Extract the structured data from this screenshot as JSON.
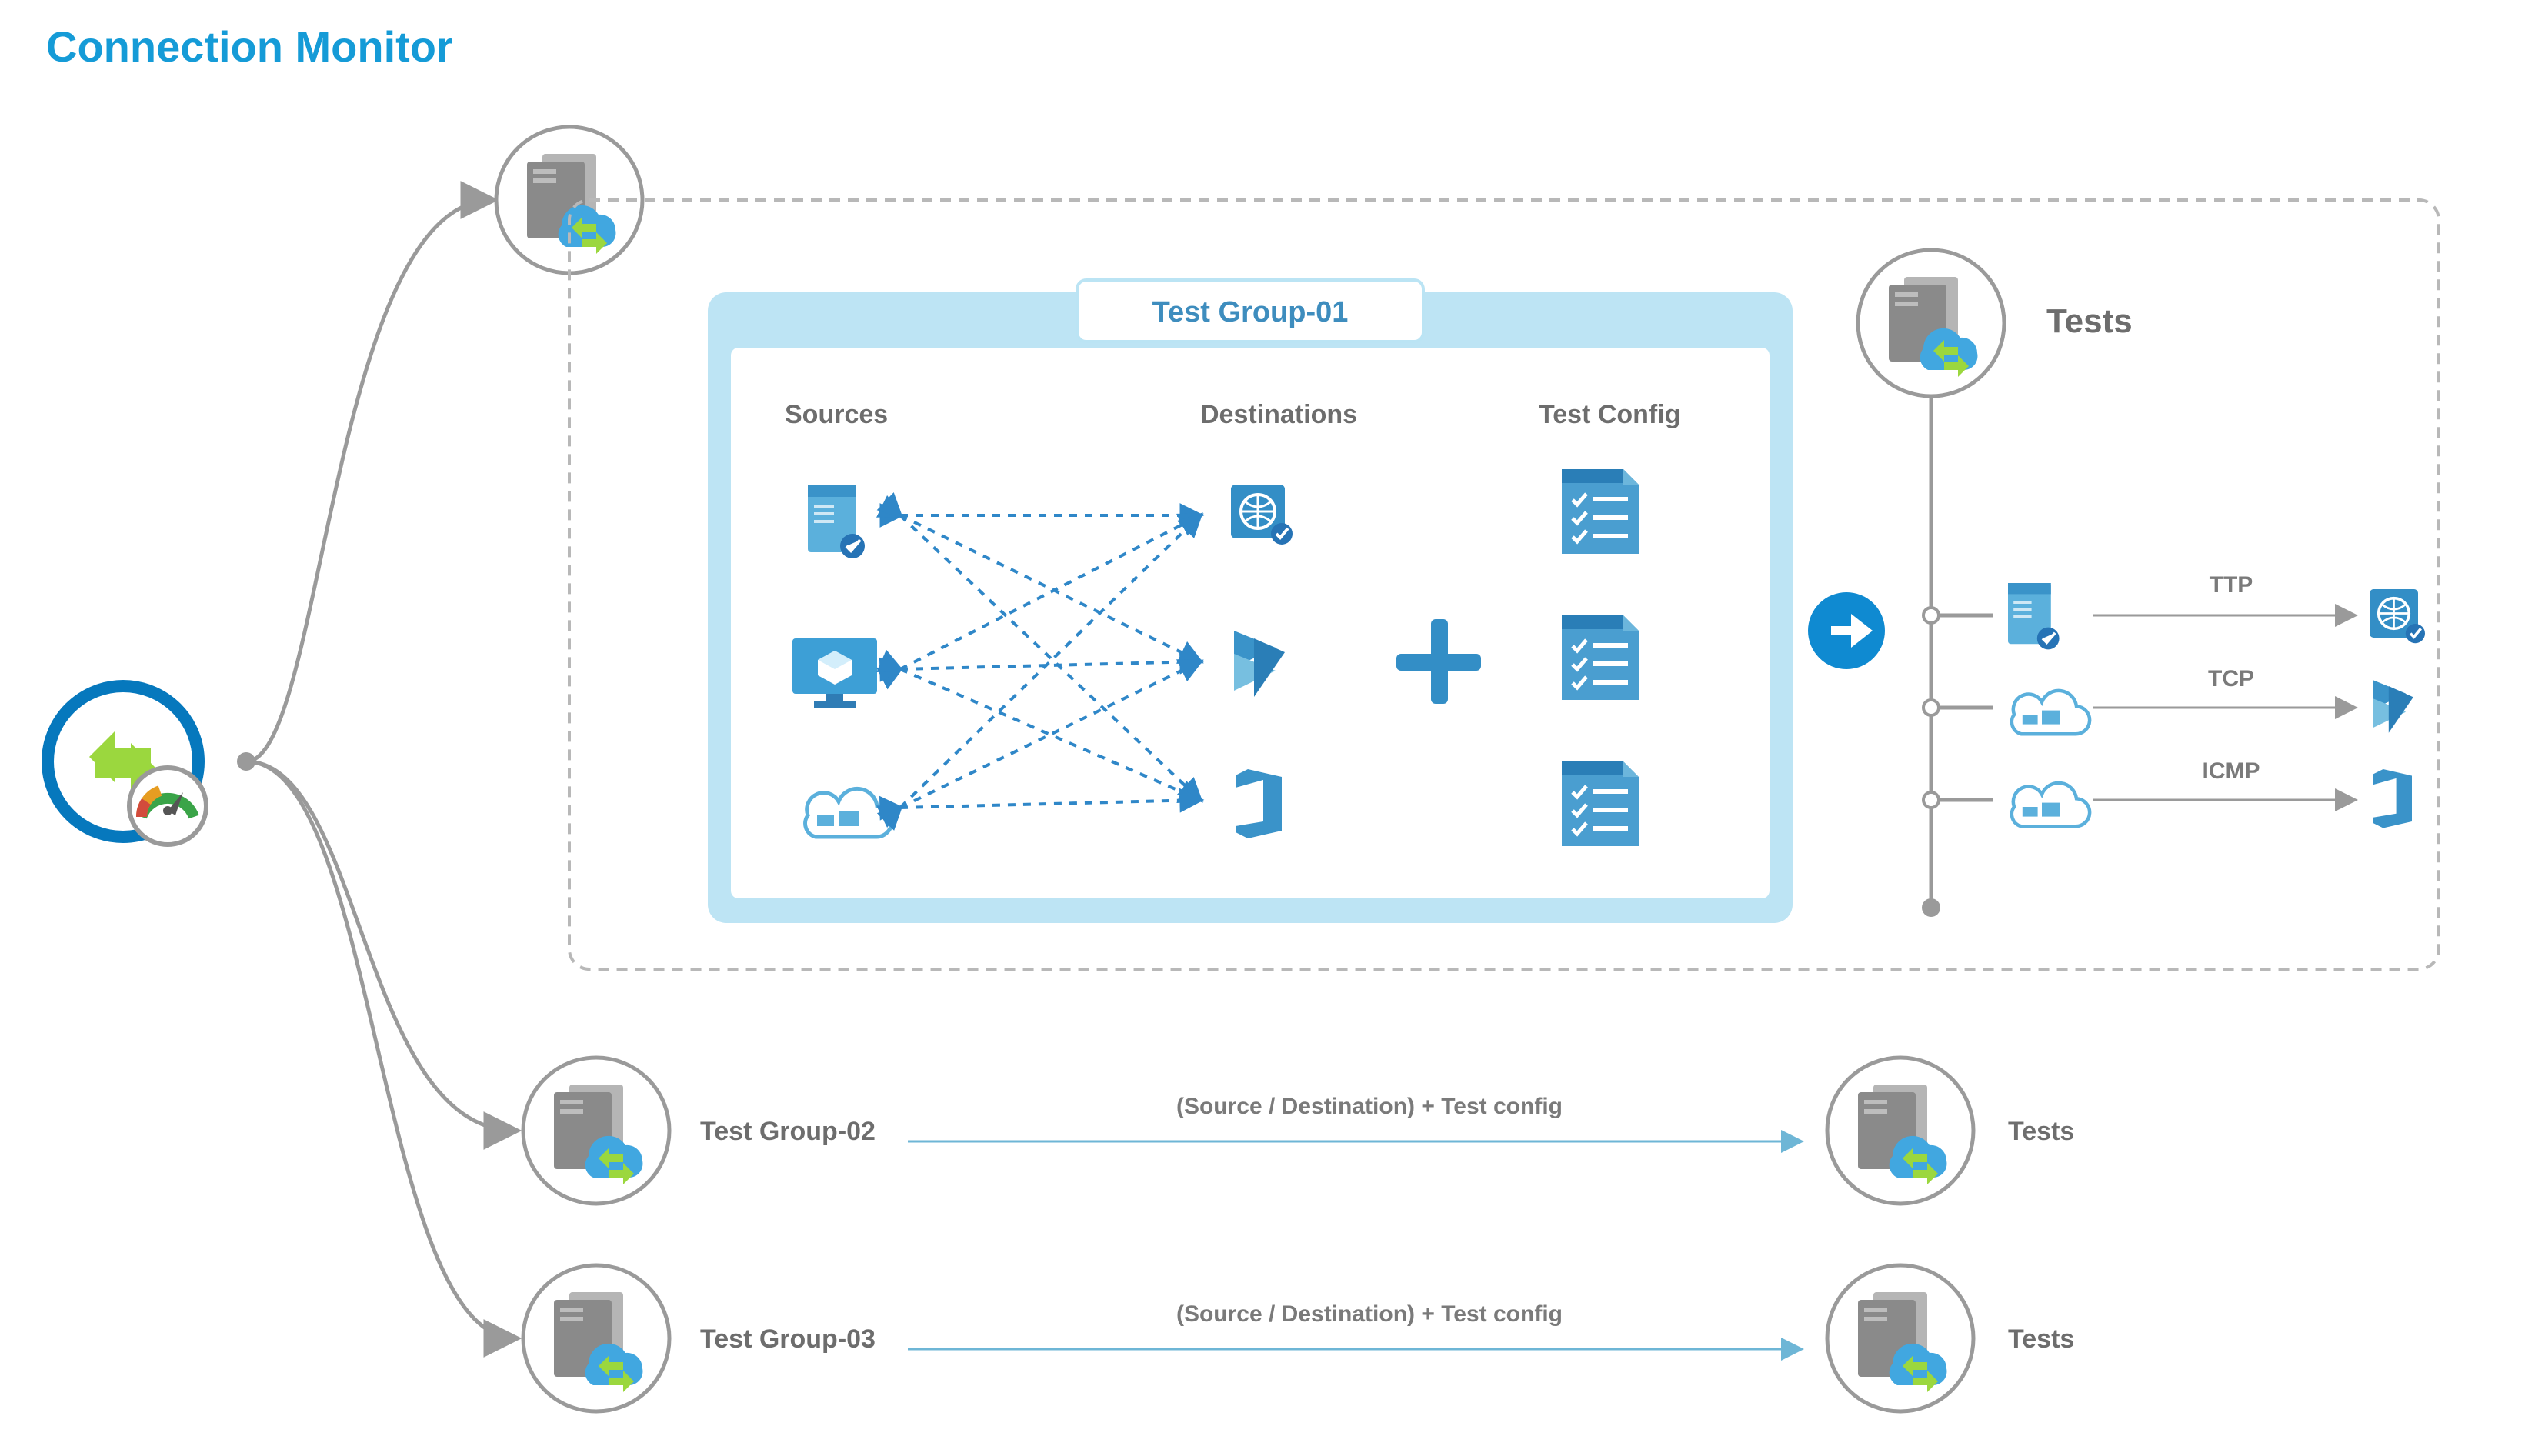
{
  "title": "Connection Monitor",
  "panel": {
    "tab": "Test Group-01",
    "columns": {
      "sources": "Sources",
      "destinations": "Destinations",
      "config": "Test Config"
    }
  },
  "tests_heading": "Tests",
  "protocols": [
    "TTP",
    "TCP",
    "ICMP"
  ],
  "rows": [
    {
      "group": "Test Group-02",
      "note": "(Source / Destination) + Test config",
      "result": "Tests"
    },
    {
      "group": "Test Group-03",
      "note": "(Source / Destination) + Test config",
      "result": "Tests"
    }
  ],
  "colors": {
    "brand_blue": "#159BD7",
    "azure_blue": "#338ec6",
    "panel_blue": "#bde4f4",
    "grey": "#8a8a8a"
  }
}
